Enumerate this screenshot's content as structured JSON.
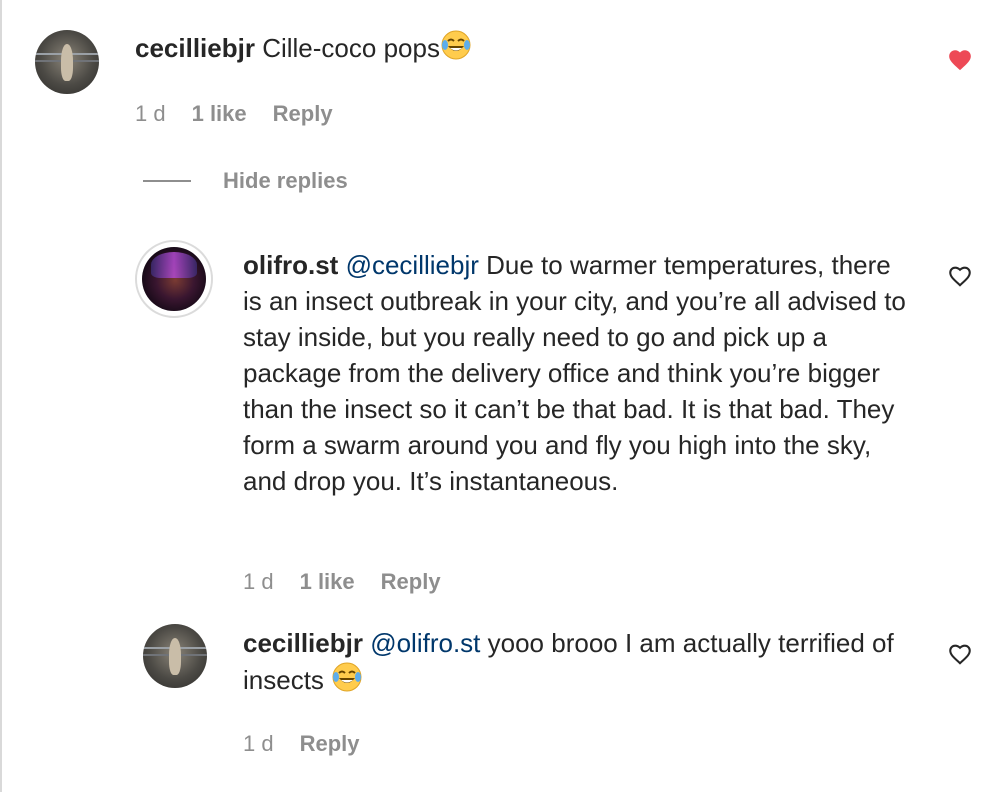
{
  "comments": [
    {
      "username": "cecilliebjr",
      "text": "Cille-coco pops",
      "emoji": "joy-emoji",
      "meta": {
        "age": "1 d",
        "likes": "1 like",
        "reply": "Reply"
      },
      "liked": true,
      "heart_color": "#ed4956"
    }
  ],
  "hide_replies_label": "Hide replies",
  "replies": [
    {
      "username": "olifro.st",
      "mention": "@cecilliebjr",
      "text": "Due to warmer temperatures, there is an insect outbreak in your city, and you’re all advised to stay inside, but you really need to go and pick up a package from the delivery office and think you’re bigger than the insect so it can’t be that bad. It is that bad. They form a swarm around you and fly you high into the sky, and drop you. It’s instantaneous.",
      "meta": {
        "age": "1 d",
        "likes": "1 like",
        "reply": "Reply"
      },
      "liked": false
    },
    {
      "username": "cecilliebjr",
      "mention": "@olifro.st",
      "text": "yooo brooo I am actually terrified of insects",
      "emoji": "joy-emoji",
      "meta": {
        "age": "1 d",
        "reply": "Reply"
      },
      "liked": false
    }
  ],
  "colors": {
    "text": "#262626",
    "muted": "#8e8e8e",
    "mention": "#00376b",
    "heart_liked": "#ed4956"
  }
}
